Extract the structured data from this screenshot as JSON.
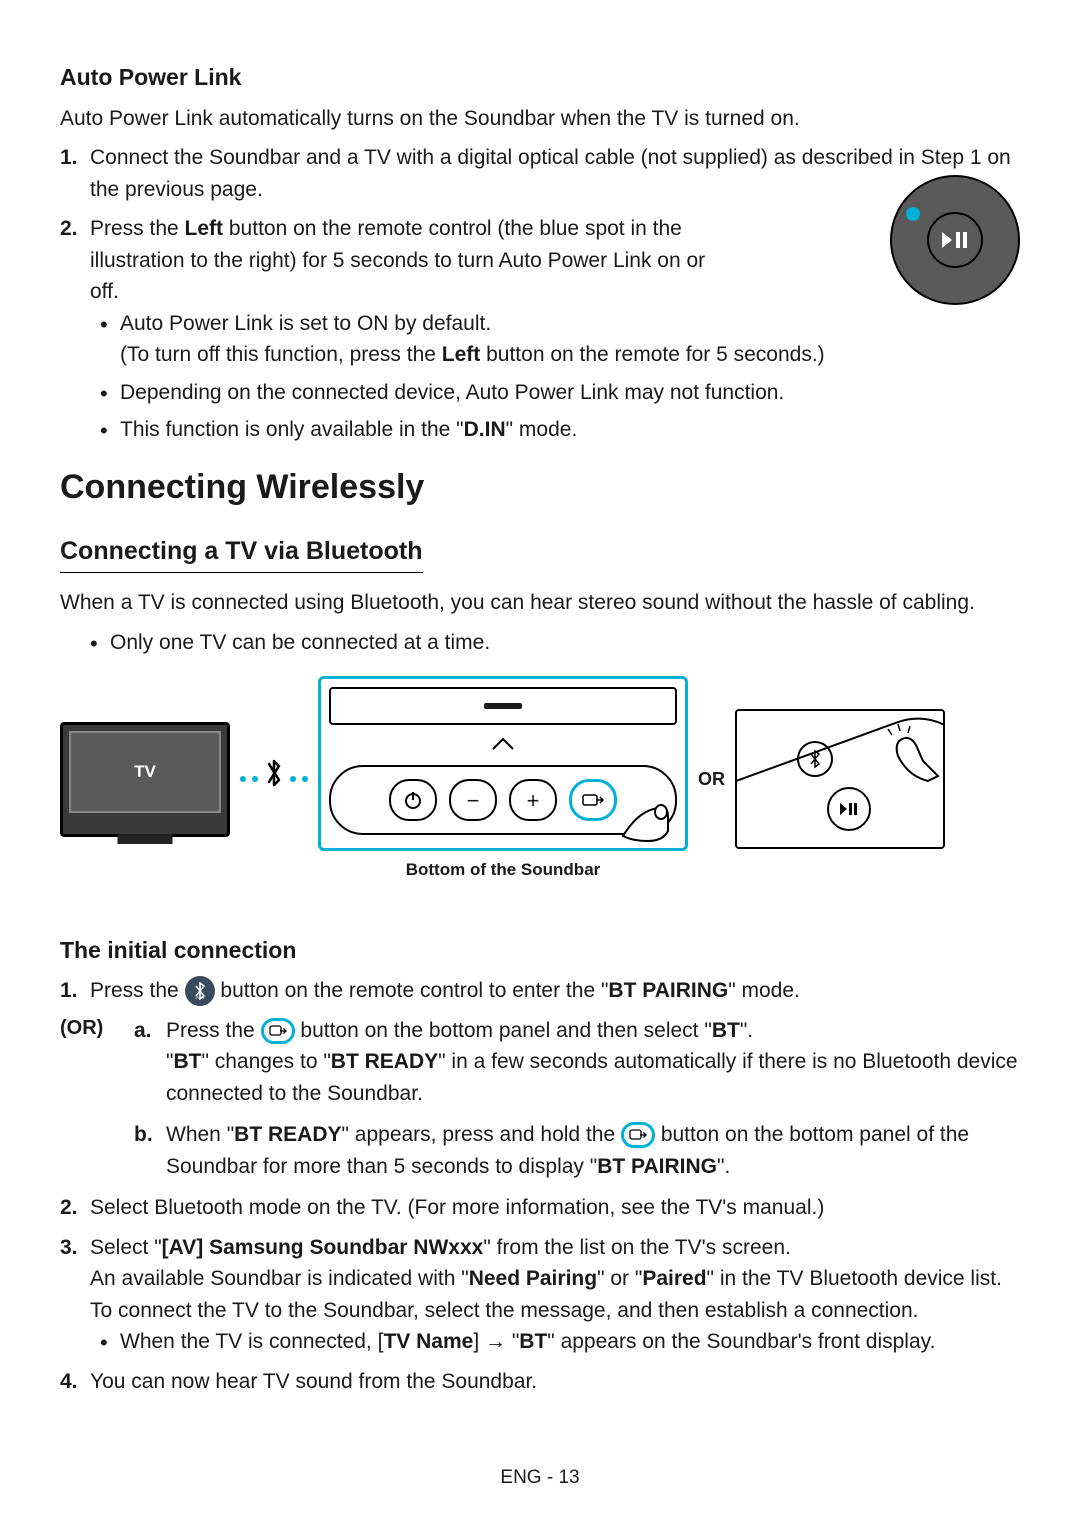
{
  "autoPowerLink": {
    "title": "Auto Power Link",
    "intro": "Auto Power Link automatically turns on the Soundbar when the TV is turned on.",
    "step1": "Connect the Soundbar and a TV with a digital optical cable (not supplied) as described in Step 1 on the previous page.",
    "step2_a": "Press the ",
    "step2_left": "Left",
    "step2_b": " button on the remote control (the blue spot in the illustration to the right) for 5 seconds to turn Auto Power Link on or off.",
    "bullet1": "Auto Power Link is set to ON by default.",
    "bullet1_sub_a": "(To turn off this function, press the ",
    "bullet1_sub_left": "Left",
    "bullet1_sub_b": " button on the remote for 5 seconds.)",
    "bullet2": "Depending on the connected device, Auto Power Link may not function.",
    "bullet3_a": "This function is only available in the \"",
    "bullet3_din": "D.IN",
    "bullet3_b": "\" mode."
  },
  "connecting": {
    "heading": "Connecting Wirelessly",
    "subheading": "Connecting a TV via Bluetooth",
    "intro": "When a TV is connected using Bluetooth, you can hear stereo sound without the hassle of cabling.",
    "bullet1": "Only one TV can be connected at a time.",
    "tvLabel": "TV",
    "soundbarCaption": "Bottom of the Soundbar",
    "orText": "OR"
  },
  "initial": {
    "title": "The initial connection",
    "step1_a": "Press the ",
    "step1_b": " button on the remote control to enter the \"",
    "step1_bt_pairing": "BT PAIRING",
    "step1_c": "\" mode.",
    "orLabel": "(OR)",
    "subA_a": "Press the ",
    "subA_b": " button on the bottom panel and then select \"",
    "subA_bt": "BT",
    "subA_c": "\".",
    "subA_line2_a": "\"",
    "subA_line2_bt": "BT",
    "subA_line2_b": "\" changes to \"",
    "subA_line2_btready": "BT READY",
    "subA_line2_c": "\" in a few seconds automatically if there is no Bluetooth device connected to the Soundbar.",
    "subB_a": "When \"",
    "subB_btready": "BT READY",
    "subB_b": "\" appears, press and hold the ",
    "subB_c": " button on the bottom panel of the Soundbar for more than 5 seconds to display \"",
    "subB_btpairing": "BT PAIRING",
    "subB_d": "\".",
    "step2": "Select Bluetooth mode on the TV. (For more information, see the TV's manual.)",
    "step3_a": "Select \"",
    "step3_name": "[AV] Samsung Soundbar NWxxx",
    "step3_b": "\" from the list on the TV's screen.",
    "step3_line2_a": "An available Soundbar is indicated with \"",
    "step3_needpairing": "Need Pairing",
    "step3_line2_b": "\" or \"",
    "step3_paired": "Paired",
    "step3_line2_c": "\" in the TV Bluetooth device list. To connect the TV to the Soundbar, select the message, and then establish a connection.",
    "step3_bullet_a": "When the TV is connected, [",
    "step3_tvname": "TV Name",
    "step3_bullet_b": "] → \"",
    "step3_bt": "BT",
    "step3_bullet_c": "\" appears on the Soundbar's front display.",
    "step4": "You can now hear TV sound from the Soundbar."
  },
  "icons": {
    "btPair": "✱",
    "playPause": "▶||",
    "source": "⇨"
  },
  "footer": "ENG - 13"
}
